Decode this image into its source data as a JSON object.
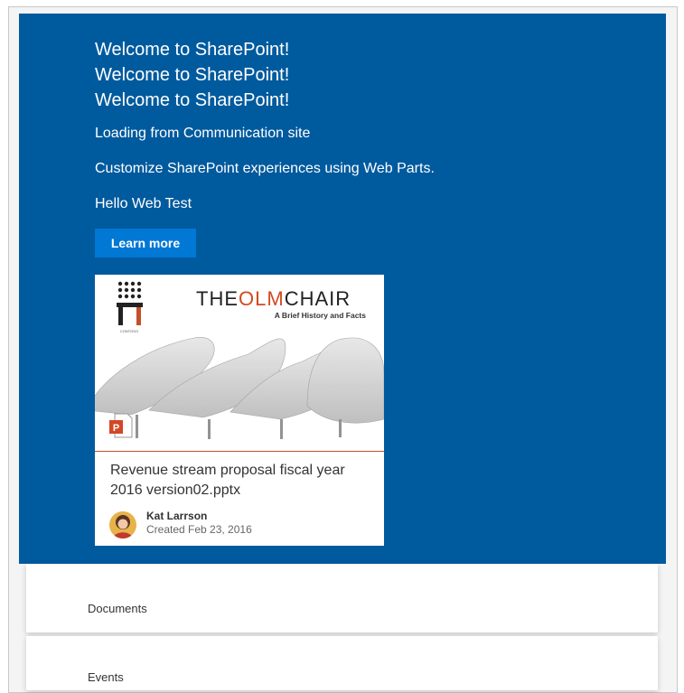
{
  "hero": {
    "welcome_lines": [
      "Welcome to SharePoint!",
      "Welcome to SharePoint!",
      "Welcome to SharePoint!"
    ],
    "loading_text": "Loading from Communication site",
    "customize_text": "Customize SharePoint experiences using Web Parts.",
    "hello_text": "Hello Web Test",
    "learn_more_label": "Learn more",
    "bg_color": "#005a9e",
    "button_color": "#0078d4"
  },
  "document_card": {
    "brand_title": "THEOLMCHAIR",
    "brand_subtitle": "A Brief History and Facts",
    "logo_caption": "CONTOSO",
    "title": "Revenue stream proposal fiscal year 2016 version02.pptx",
    "author": "Kat Larrson",
    "created": "Created Feb 23, 2016",
    "file_type_icon": "powerpoint-icon"
  },
  "sections": [
    {
      "label": "Documents"
    },
    {
      "label": "Events"
    }
  ]
}
